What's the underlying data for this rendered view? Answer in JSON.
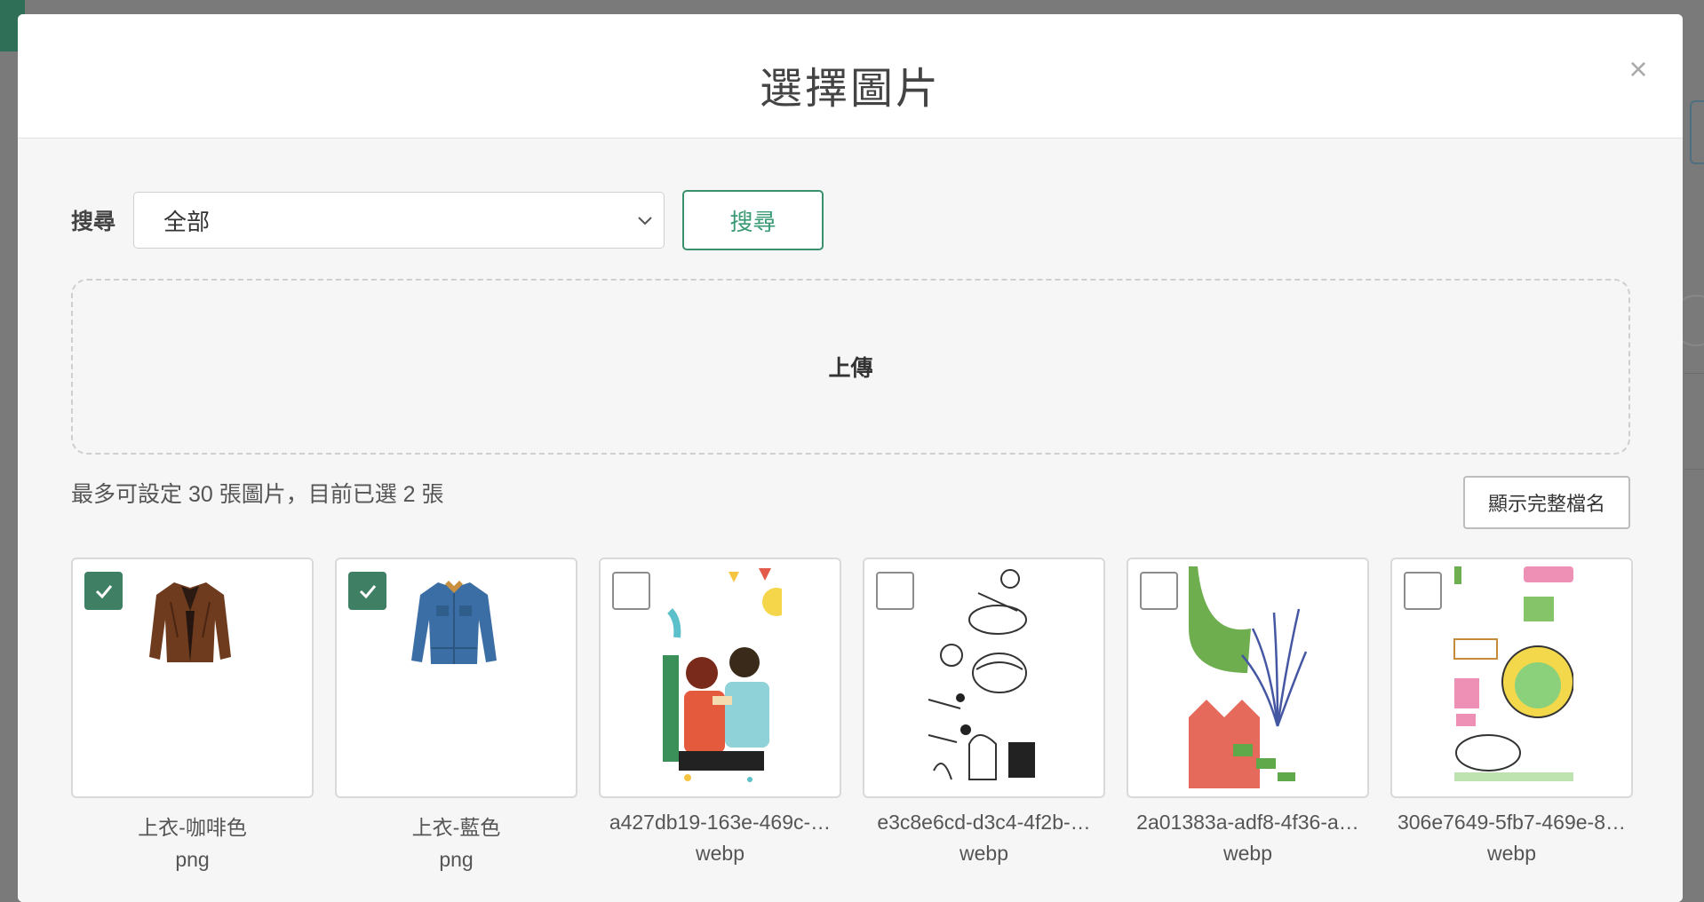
{
  "modal": {
    "title": "選擇圖片",
    "close_symbol": "×"
  },
  "search": {
    "label": "搜尋",
    "selected": "全部",
    "button": "搜尋"
  },
  "upload": {
    "label": "上傳"
  },
  "info": {
    "text": "最多可設定 30 張圖片，目前已選 2 張",
    "fullname_button": "顯示完整檔名"
  },
  "images": [
    {
      "name": "上衣-咖啡色",
      "ext": "png",
      "checked": true,
      "icon": "brown-jacket-image"
    },
    {
      "name": "上衣-藍色",
      "ext": "png",
      "checked": true,
      "icon": "denim-jacket-image"
    },
    {
      "name": "a427db19-163e-469c-…",
      "ext": "webp",
      "checked": false,
      "icon": "party-illustration-image"
    },
    {
      "name": "e3c8e6cd-d3c4-4f2b-…",
      "ext": "webp",
      "checked": false,
      "icon": "doodle-illustration-image"
    },
    {
      "name": "2a01383a-adf8-4f36-a…",
      "ext": "webp",
      "checked": false,
      "icon": "abstract-leaf-image"
    },
    {
      "name": "306e7649-5fb7-469e-8…",
      "ext": "webp",
      "checked": false,
      "icon": "sticker-collage-image"
    }
  ],
  "colors": {
    "accent": "#3a8f6d",
    "checked": "#3f7f64"
  }
}
